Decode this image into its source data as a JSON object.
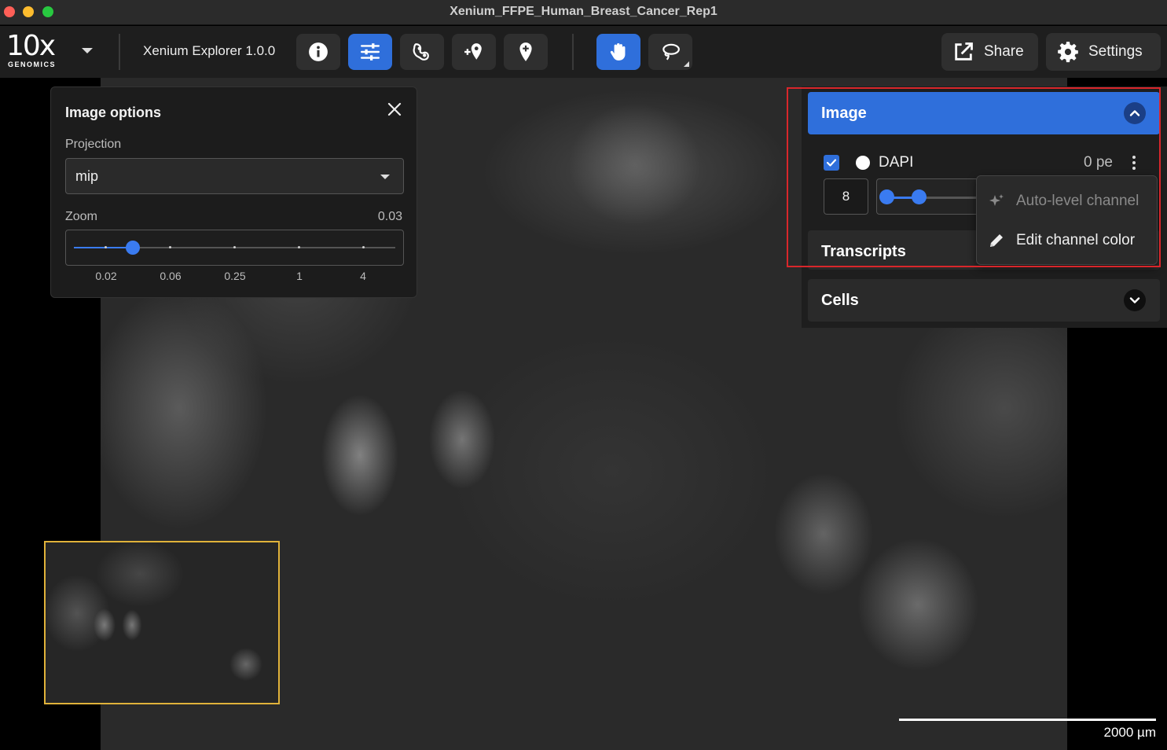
{
  "window": {
    "title": "Xenium_FFPE_Human_Breast_Cancer_Rep1"
  },
  "toolbar": {
    "logo_main": "10x",
    "logo_sub": "GENOMICS",
    "app_version": "Xenium Explorer 1.0.0",
    "share_label": "Share",
    "settings_label": "Settings",
    "accent_color": "#2f6fdb"
  },
  "image_options": {
    "title": "Image options",
    "projection_label": "Projection",
    "projection_value": "mip",
    "zoom_label": "Zoom",
    "zoom_value": "0.03",
    "zoom_ticks": [
      "0.02",
      "0.06",
      "0.25",
      "1",
      "4"
    ]
  },
  "layers": {
    "image": {
      "label": "Image",
      "channel": {
        "name": "DAPI",
        "checked": true,
        "value_text": "0 pe",
        "min_box": "8"
      }
    },
    "transcripts": {
      "label": "Transcripts"
    },
    "cells": {
      "label": "Cells"
    }
  },
  "context_menu": {
    "items": [
      {
        "label": "Auto-level channel",
        "enabled": false
      },
      {
        "label": "Edit channel color",
        "enabled": true
      }
    ]
  },
  "scale_bar": {
    "label": "2000  µm"
  }
}
